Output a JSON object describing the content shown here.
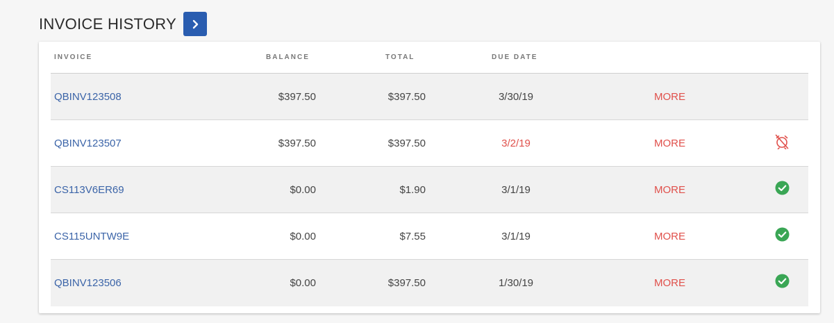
{
  "header": {
    "title": "INVOICE HISTORY"
  },
  "table": {
    "columns": {
      "invoice": "INVOICE",
      "balance": "BALANCE",
      "total": "TOTAL",
      "due_date": "DUE DATE"
    },
    "rows": [
      {
        "invoice": "QBINV123508",
        "balance": "$397.50",
        "total": "$397.50",
        "due_date": "3/30/19",
        "action": "MORE",
        "status": "none"
      },
      {
        "invoice": "QBINV123507",
        "balance": "$397.50",
        "total": "$397.50",
        "due_date": "3/2/19",
        "action": "MORE",
        "status": "overdue-alarm-icon"
      },
      {
        "invoice": "CS113V6ER69",
        "balance": "$0.00",
        "total": "$1.90",
        "due_date": "3/1/19",
        "action": "MORE",
        "status": "paid-check-icon"
      },
      {
        "invoice": "CS115UNTW9E",
        "balance": "$0.00",
        "total": "$7.55",
        "due_date": "3/1/19",
        "action": "MORE",
        "status": "paid-check-icon"
      },
      {
        "invoice": "QBINV123506",
        "balance": "$0.00",
        "total": "$397.50",
        "due_date": "1/30/19",
        "action": "MORE",
        "status": "paid-check-icon"
      }
    ]
  },
  "colors": {
    "accent": "#2a5db0",
    "link": "#3b64a8",
    "danger": "#e0504b",
    "success": "#3aa655"
  }
}
